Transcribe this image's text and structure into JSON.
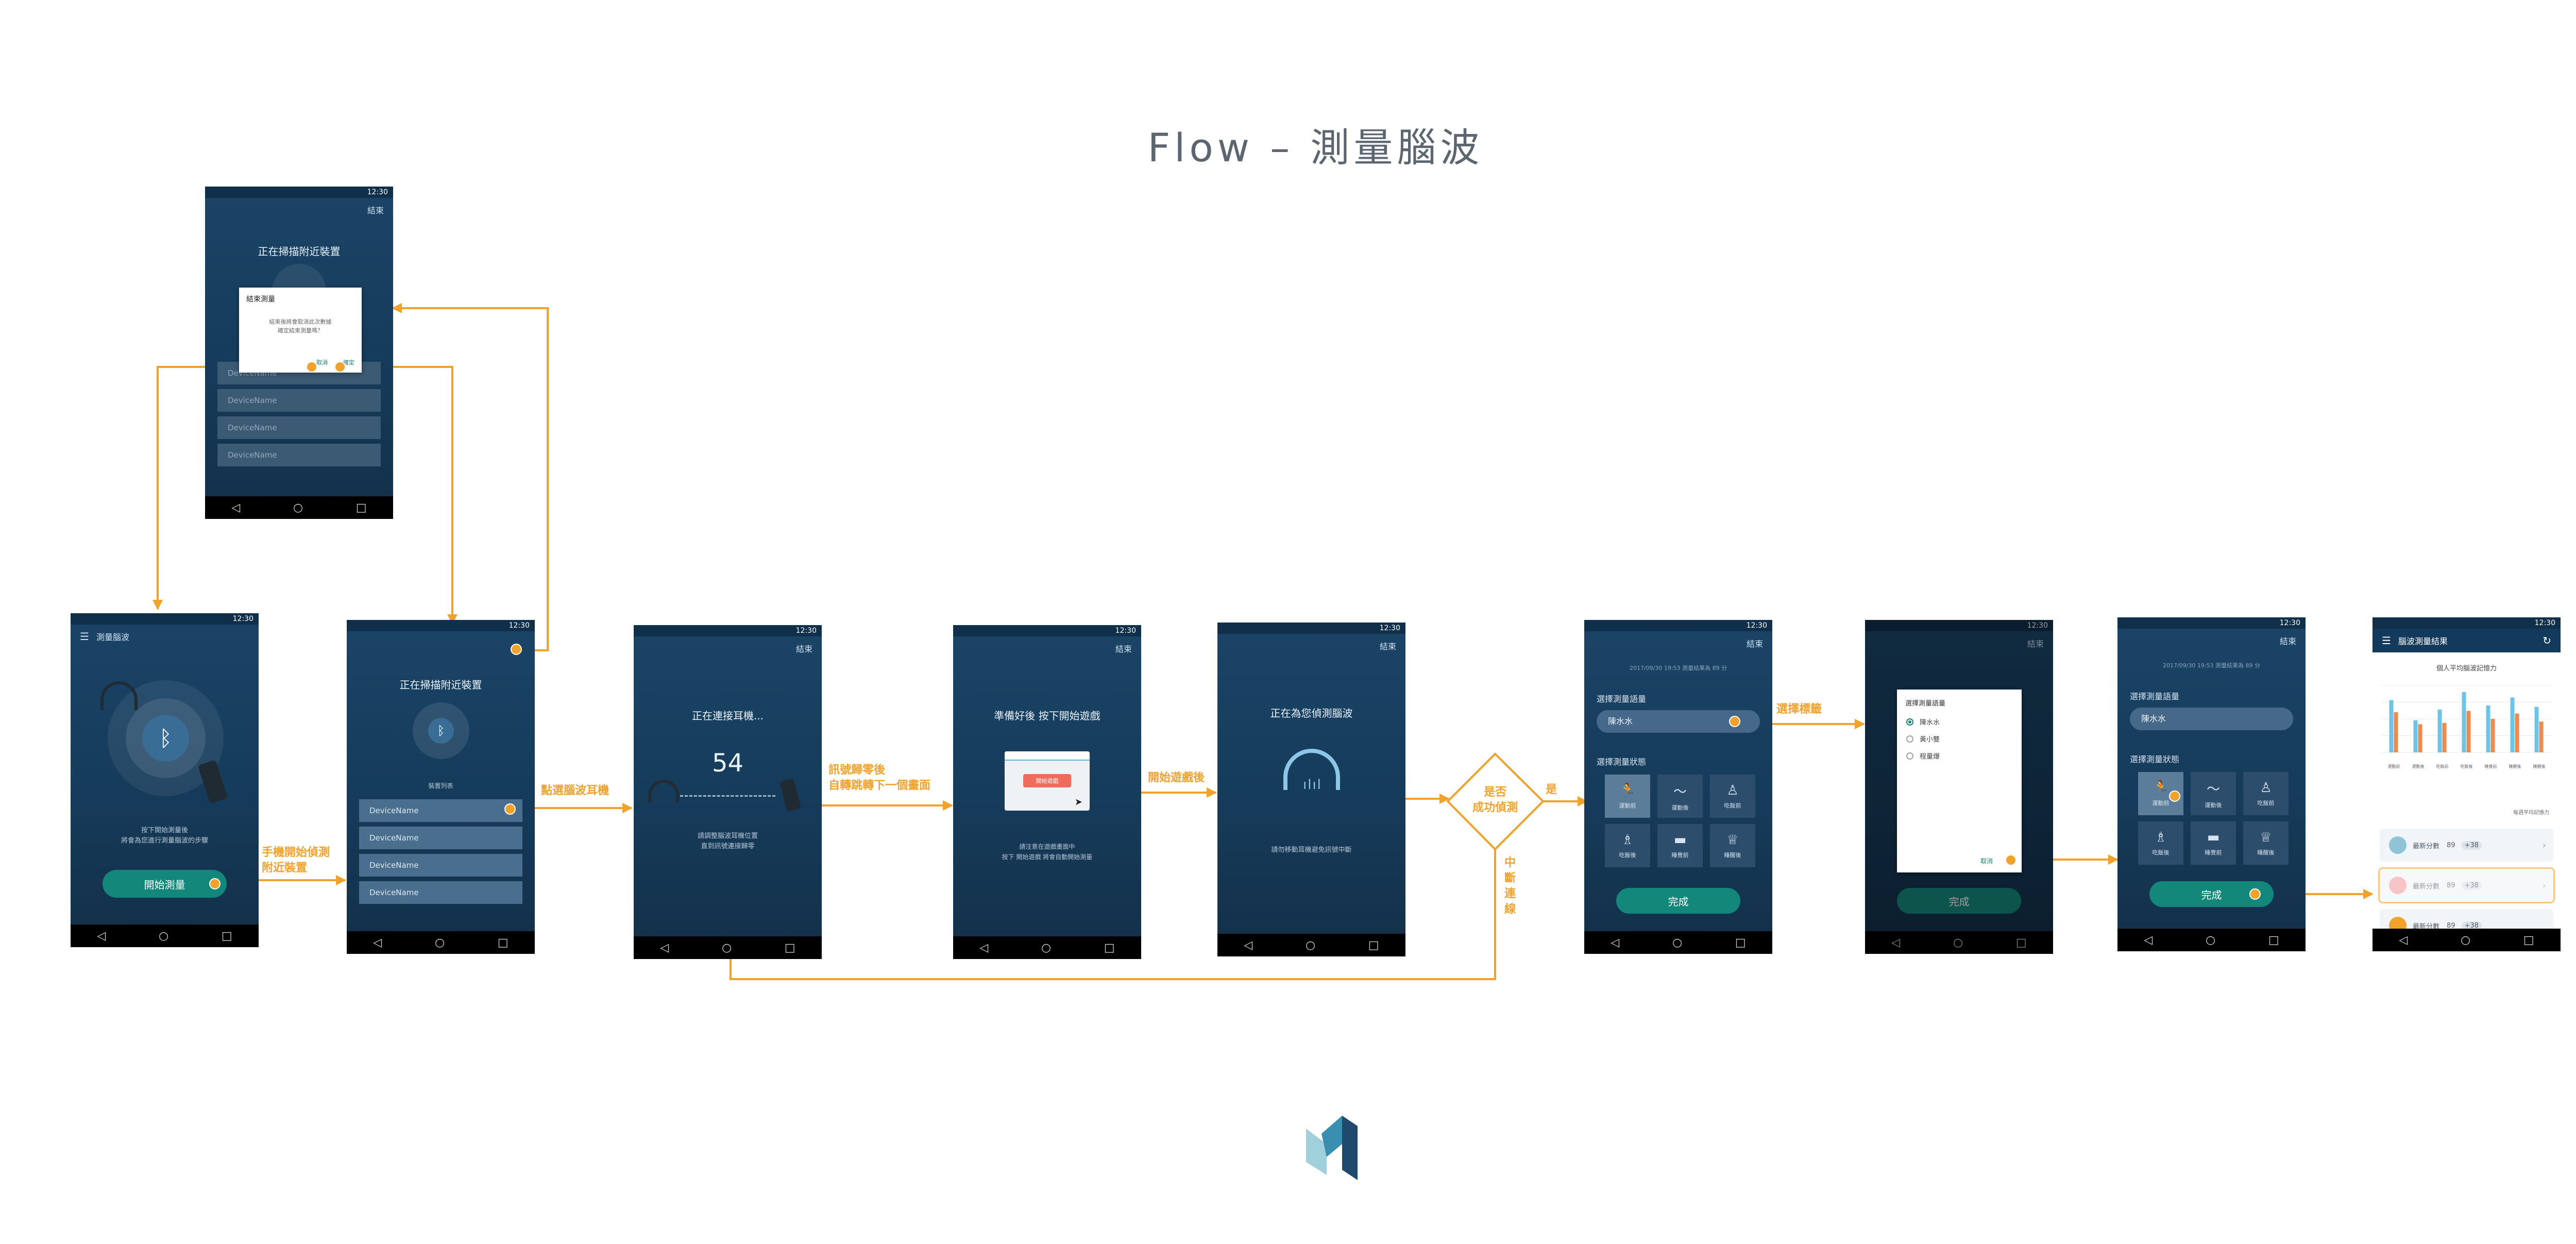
{
  "title": "Flow – 測量腦波",
  "colors": {
    "accent": "#f0a22b",
    "teal_button": "#13877a",
    "phone_bg": "#163b5a"
  },
  "status_time": "12:30",
  "nav_glyphs": [
    "◁",
    "○",
    "□"
  ],
  "labels": {
    "start_search": "手機開始偵測\n附近裝置",
    "tap_headset": "點選腦波耳機",
    "signal_zero": "訊號歸零後\n自轉跳轉下一個畫面",
    "after_game": "開始遊戲後",
    "decision": "是否\n成功偵測",
    "yes": "是",
    "interrupted": "中\n斷\n連\n線",
    "choose_tag": "選擇標籤"
  },
  "screen_end_dialog": {
    "header_right": "結束",
    "title": "正在掃描附近裝置",
    "dialog_title": "結束測量",
    "dialog_body": "結束後將會取消此次數據\n確定結束測量嗎？",
    "btn_cancel": "取消",
    "btn_ok": "確定",
    "devices": [
      "DeviceName",
      "DeviceName",
      "DeviceName",
      "DeviceName"
    ]
  },
  "screen_start": {
    "app_title": "測量腦波",
    "hint": "按下開始測量後\n將會為您進行測量腦波的步驟",
    "button": "開始測量"
  },
  "screen_scan": {
    "title": "正在掃描附近裝置",
    "list_label": "裝置列表",
    "devices": [
      "DeviceName",
      "DeviceName",
      "DeviceName",
      "DeviceName"
    ]
  },
  "screen_connect": {
    "header_right": "結束",
    "title": "正在連接耳機...",
    "count": "54",
    "hint": "請調整腦波耳機位置\n直到訊號連接歸零"
  },
  "screen_game": {
    "header_right": "結束",
    "title": "準備好後 按下開始遊戲",
    "game_button": "開始遊戲",
    "hint": "請注意在遊戲畫面中\n按下 開始遊戲 將會自動開始測量"
  },
  "screen_detect": {
    "header_right": "結束",
    "title": "正在為您偵測腦波",
    "hint": "請勿移動耳機避免訊號中斷"
  },
  "screen_tag": {
    "header_right": "結束",
    "meta": "2017/09/30 19:53   測量結果為 89 分",
    "tag_label": "選擇測量語量",
    "tag_value": "陳水水",
    "state_label": "選擇測量狀態",
    "states": [
      "運動前",
      "運動後",
      "吃飯前",
      "吃飯後",
      "睡覺前",
      "睡醒後"
    ],
    "button": "完成"
  },
  "screen_tag_dialog": {
    "header_right": "結束",
    "dialog_title": "選擇測量語量",
    "options": [
      "陳水水",
      "黃小雙",
      "程量爆"
    ],
    "btn_cancel": "取消",
    "btn_ok": "確",
    "button": "完成"
  },
  "screen_result": {
    "app_title": "腦波測量結果",
    "chart_title": "個人平均腦波記憶力",
    "chart_note": "每週平均記憶力",
    "rows": [
      {
        "label": "最新分數",
        "score": "89",
        "badge": "+38"
      },
      {
        "label": "最新分數",
        "score": "89",
        "badge": "+38"
      },
      {
        "label": "最新分數",
        "score": "89",
        "badge": "+38"
      }
    ]
  },
  "chart_data": {
    "type": "bar",
    "categories": [
      "運動前",
      "運動後",
      "吃飯前",
      "吃飯後",
      "睡覺前",
      "睡醒後",
      "睡醒後"
    ],
    "series": [
      {
        "values": [
          78,
          48,
          64,
          90,
          70,
          82,
          68
        ]
      },
      {
        "values": [
          60,
          42,
          44,
          62,
          50,
          58,
          46
        ]
      }
    ],
    "colors": [
      "#6cc5e6",
      "#ee8a4c"
    ],
    "ylim": [
      0,
      100
    ]
  }
}
